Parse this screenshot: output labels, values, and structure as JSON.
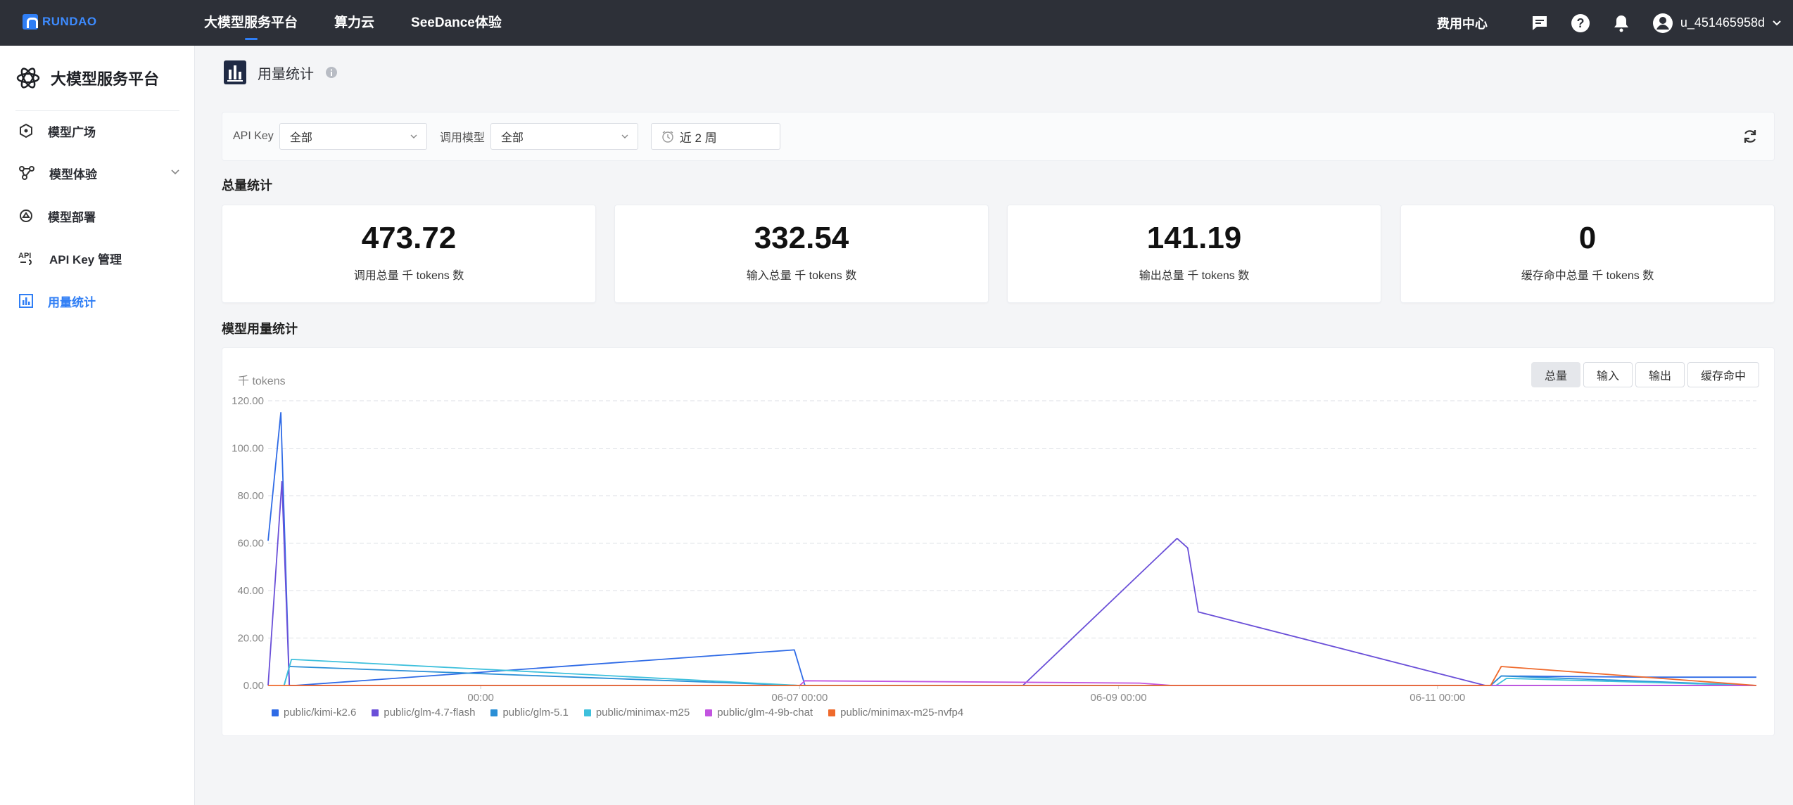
{
  "topbar": {
    "logo_text": "RUNDAO",
    "nav": [
      "大模型服务平台",
      "算力云",
      "SeeDance体验"
    ],
    "fee_center": "费用中心",
    "username": "u_451465958d"
  },
  "sidebar": {
    "brand": "大模型服务平台",
    "items": [
      {
        "label": "模型广场",
        "icon": "hexagon-icon"
      },
      {
        "label": "模型体验",
        "icon": "nodes-icon"
      },
      {
        "label": "模型部署",
        "icon": "deploy-icon"
      },
      {
        "label": "API Key 管理",
        "icon": "api-icon"
      },
      {
        "label": "用量统计",
        "icon": "bar-chart-icon"
      }
    ]
  },
  "page": {
    "title": "用量统计"
  },
  "filters": {
    "apikey_label": "API Key",
    "apikey_value": "全部",
    "model_label": "调用模型",
    "model_value": "全部",
    "date_value": "近 2 周"
  },
  "total_stats": {
    "title": "总量统计",
    "cards": [
      {
        "value": "473.72",
        "label": "调用总量 千 tokens 数"
      },
      {
        "value": "332.54",
        "label": "输入总量 千 tokens 数"
      },
      {
        "value": "141.19",
        "label": "输出总量 千 tokens 数"
      },
      {
        "value": "0",
        "label": "缓存命中总量 千 tokens 数"
      }
    ]
  },
  "model_stats": {
    "title": "模型用量统计",
    "tabs": [
      "总量",
      "输入",
      "输出",
      "缓存命中"
    ],
    "unit": "千 tokens"
  },
  "colors": {
    "accent": "#2f7ef5",
    "topbar": "#2d3038"
  },
  "chart_data": {
    "type": "line",
    "ylim": [
      0,
      120
    ],
    "y_ticks": [
      "0.00",
      "20.00",
      "40.00",
      "60.00",
      "80.00",
      "100.00",
      "120.00"
    ],
    "x_range": [
      0,
      14
    ],
    "x_ticks": [
      {
        "x": 2,
        "label": "00:00"
      },
      {
        "x": 5,
        "label": "06-07 00:00"
      },
      {
        "x": 8,
        "label": "06-09 00:00"
      },
      {
        "x": 11,
        "label": "06-11 00:00"
      }
    ],
    "grid": true,
    "legend_position": "bottom-left",
    "series": [
      {
        "name": "public/kimi-k2.6",
        "color": "#2f6be6",
        "points": [
          [
            0,
            61
          ],
          [
            0.12,
            115
          ],
          [
            0.2,
            0
          ],
          [
            0.25,
            0
          ],
          [
            4.95,
            15
          ],
          [
            5.05,
            0
          ],
          [
            11.5,
            0
          ],
          [
            11.6,
            4
          ],
          [
            13,
            3.5
          ],
          [
            14,
            3.5
          ]
        ]
      },
      {
        "name": "public/glm-4.7-flash",
        "color": "#6a4fd8",
        "points": [
          [
            0,
            0
          ],
          [
            0.13,
            86
          ],
          [
            0.2,
            0
          ],
          [
            7.1,
            0
          ],
          [
            8.55,
            62
          ],
          [
            8.65,
            58
          ],
          [
            8.75,
            31
          ],
          [
            11.45,
            0
          ],
          [
            14,
            0
          ]
        ]
      },
      {
        "name": "public/glm-5.1",
        "color": "#2a8fd6",
        "points": [
          [
            0.15,
            0
          ],
          [
            0.2,
            8
          ],
          [
            5,
            0
          ],
          [
            11.5,
            0
          ],
          [
            11.6,
            4
          ],
          [
            14,
            0
          ]
        ]
      },
      {
        "name": "public/minimax-m25",
        "color": "#3ec0dc",
        "points": [
          [
            0.15,
            0
          ],
          [
            0.22,
            11
          ],
          [
            5,
            0
          ],
          [
            11.55,
            0
          ],
          [
            11.65,
            3
          ],
          [
            14,
            0
          ]
        ]
      },
      {
        "name": "public/glm-4-9b-chat",
        "color": "#c254e0",
        "points": [
          [
            5,
            0
          ],
          [
            5.05,
            2
          ],
          [
            8.2,
            1
          ],
          [
            8.5,
            0
          ],
          [
            14,
            0
          ]
        ]
      },
      {
        "name": "public/minimax-m25-nvfp4",
        "color": "#ef6a2c",
        "points": [
          [
            0,
            0
          ],
          [
            11.5,
            0
          ],
          [
            11.6,
            8
          ],
          [
            14,
            0
          ]
        ]
      }
    ]
  }
}
